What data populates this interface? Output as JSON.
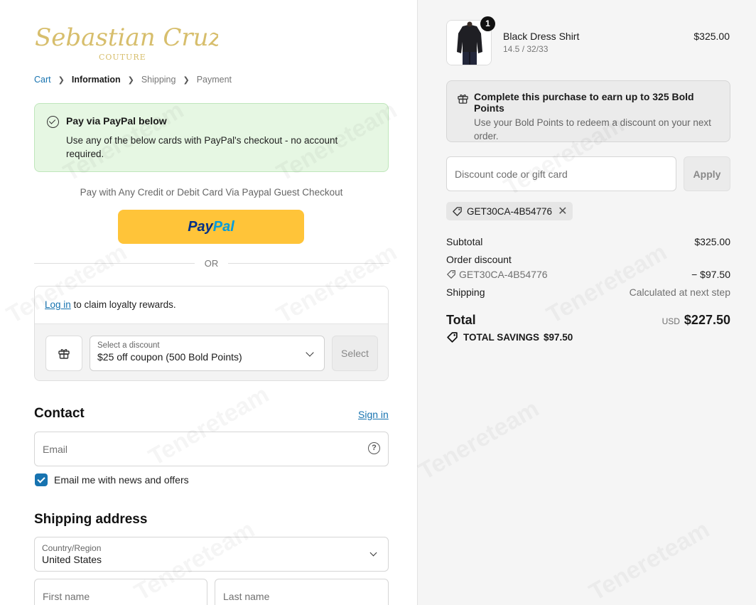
{
  "brand": {
    "logo_text": "Sebastian Cruz",
    "logo_subtext": "COUTURE"
  },
  "breadcrumb": [
    {
      "label": "Cart"
    },
    {
      "label": "Information"
    },
    {
      "label": "Shipping"
    },
    {
      "label": "Payment"
    }
  ],
  "paypal_banner": {
    "title": "Pay via PayPal below",
    "description": "Use any of the below cards with PayPal's checkout - no account required."
  },
  "paypal": {
    "note": "Pay with Any Credit or Debit Card Via Paypal Guest Checkout",
    "button_pay": "Pay",
    "button_pal": "Pal",
    "or_label": "OR"
  },
  "loyalty": {
    "login_link": "Log in",
    "login_text": " to claim loyalty rewards.",
    "discount_label": "Select a discount",
    "discount_value": "$25 off coupon (500 Bold Points)",
    "select_button": "Select"
  },
  "contact": {
    "title": "Contact",
    "sign_in": "Sign in",
    "email_placeholder": "Email",
    "newsletter_label": "Email me with news and offers",
    "newsletter_checked": true
  },
  "shipping_address": {
    "title": "Shipping address",
    "country_label": "Country/Region",
    "country_value": "United States",
    "first_name_placeholder": "First name",
    "last_name_placeholder": "Last name"
  },
  "cart": {
    "item_name": "Black Dress Shirt",
    "item_variant": "14.5 / 32/33",
    "item_price": "$325.00",
    "item_quantity": "1"
  },
  "bold_points": {
    "title": "Complete this purchase to earn up to 325 Bold Points",
    "description": "Use your Bold Points to redeem a discount on your next order."
  },
  "discount": {
    "placeholder": "Discount code or gift card",
    "apply_label": "Apply",
    "applied_code": "GET30CA-4B54776"
  },
  "summary": {
    "subtotal_label": "Subtotal",
    "subtotal_value": "$325.00",
    "order_discount_label": "Order discount",
    "order_discount_code": "GET30CA-4B54776",
    "order_discount_value": "− $97.50",
    "shipping_label": "Shipping",
    "shipping_value": "Calculated at next step",
    "total_label": "Total",
    "currency": "USD",
    "total_value": "$227.50",
    "savings_label": "TOTAL SAVINGS",
    "savings_value": "$97.50"
  },
  "watermark_text": "Tenereteam",
  "colors": {
    "accent": "#1773b0",
    "paypal_yellow": "#ffc439",
    "banner_green": "#e6f7e3"
  },
  "icons": [
    "check-circle-icon",
    "gift-icon",
    "chevron-down-icon",
    "help-icon",
    "tag-icon",
    "close-icon",
    "checkbox-checked-icon"
  ]
}
